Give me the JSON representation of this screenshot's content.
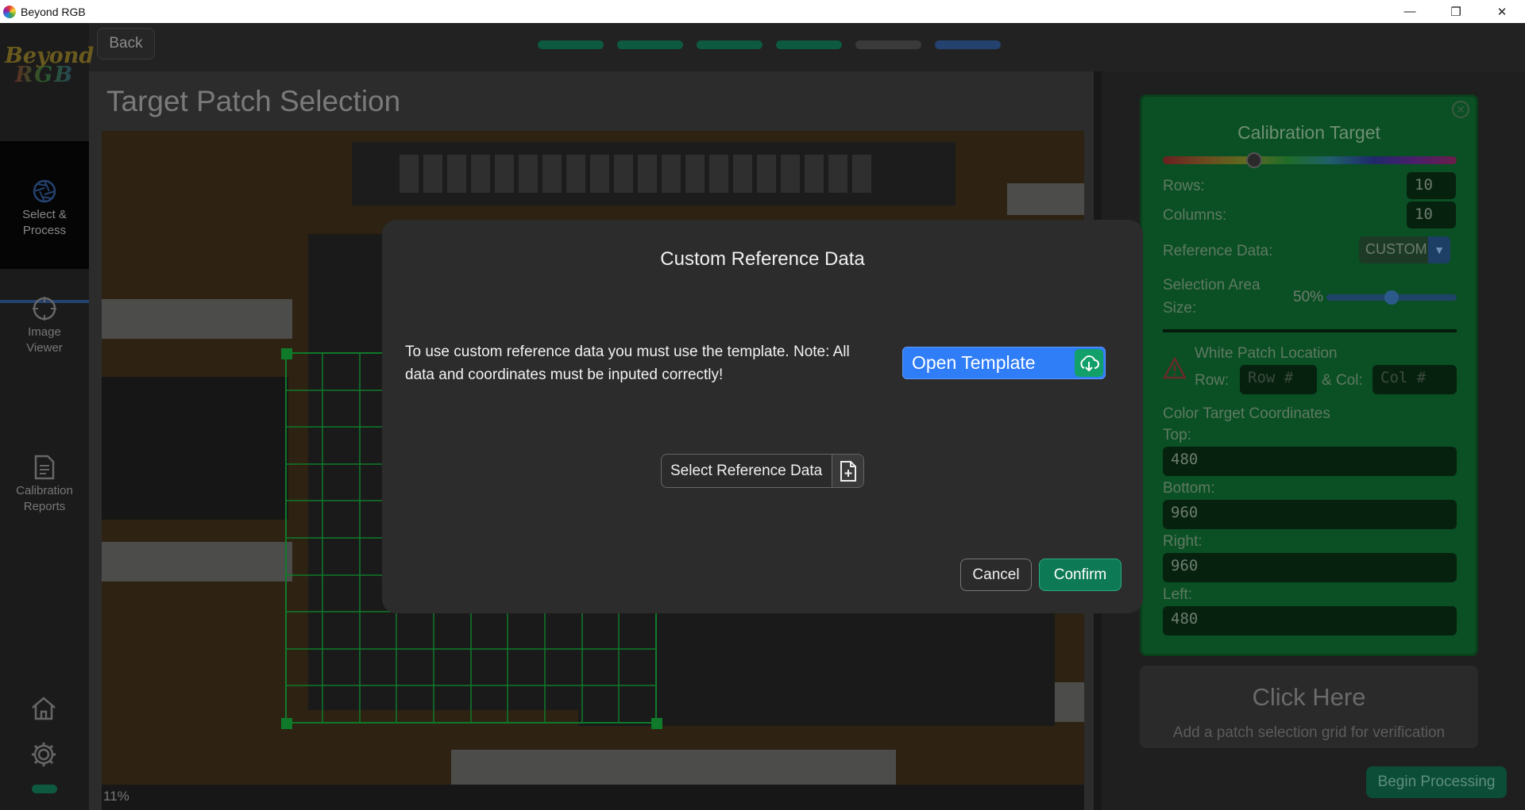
{
  "window": {
    "title": "Beyond RGB",
    "minimize": "—",
    "maximize": "❐",
    "close": "✕"
  },
  "sidebar": {
    "logo_top": "Beyond",
    "logo_bottom": "RGB",
    "items": [
      {
        "label": "Select &\nProcess",
        "icon": "aperture-icon",
        "active": true
      },
      {
        "label": "Image\nViewer",
        "icon": "crosshair-icon",
        "active": false
      },
      {
        "label": "Calibration\nReports",
        "icon": "document-icon",
        "active": false
      }
    ]
  },
  "topbar": {
    "back_label": "Back",
    "steps": [
      {
        "color": "#0d5a40"
      },
      {
        "color": "#0d5a40"
      },
      {
        "color": "#0d5a40"
      },
      {
        "color": "#0d5a40"
      },
      {
        "color": "#3a3a3a"
      },
      {
        "color": "#24426f"
      }
    ]
  },
  "main": {
    "title": "Target Patch Selection",
    "zoom": "11%"
  },
  "calibration": {
    "title": "Calibration Target",
    "hue_position": 0.31,
    "rows_label": "Rows:",
    "rows_value": "10",
    "columns_label": "Columns:",
    "columns_value": "10",
    "reference_label": "Reference Data:",
    "reference_value": "CUSTOM",
    "selection_label_1": "Selection Area",
    "selection_label_2": "Size:",
    "selection_value": "50%",
    "white_patch_label": "White Patch Location",
    "row_label": "Row:",
    "row_placeholder": "Row #",
    "col_label": "& Col:",
    "col_placeholder": "Col #",
    "coords_label": "Color Target Coordinates",
    "top_label": "Top:",
    "top_value": "480",
    "bottom_label": "Bottom:",
    "bottom_value": "960",
    "right_label": "Right:",
    "right_value": "960",
    "left_label": "Left:",
    "left_value": "480"
  },
  "verify": {
    "title": "Click Here",
    "subtitle": "Add a patch selection grid for verification"
  },
  "begin_label": "Begin Processing",
  "modal": {
    "title": "Custom Reference Data",
    "text": "To use custom reference data you must use the template. Note: All data and coordinates must be inputed correctly!",
    "open_template": "Open Template",
    "select_reference": "Select Reference Data",
    "cancel": "Cancel",
    "confirm": "Confirm"
  },
  "colors": {
    "accent_blue": "#2f7df7",
    "confirm_green": "#0e7a55",
    "card_green": "#0b4f24"
  }
}
